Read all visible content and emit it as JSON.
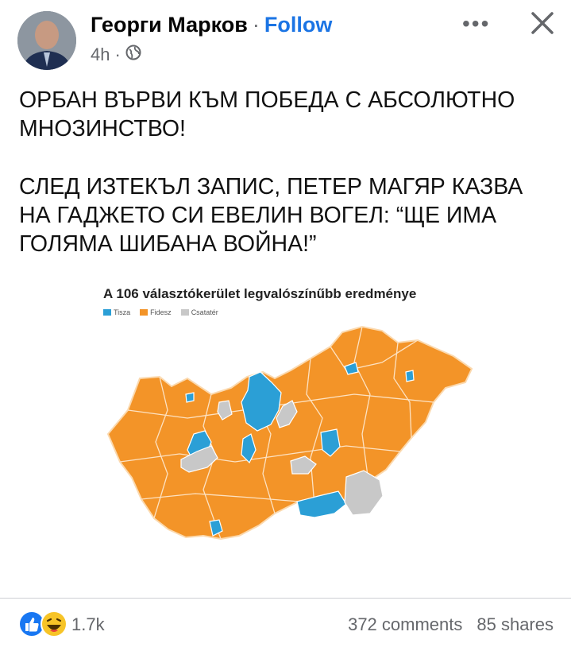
{
  "post": {
    "author": "Георги Марков",
    "separator": "·",
    "follow_label": "Follow",
    "time": "4h",
    "meta_separator": "·",
    "text_line1": "ОРБАН ВЪРВИ КЪМ ПОБЕДА С АБСОЛЮТНО МНОЗИНСТВО!",
    "text_line2": "СЛЕД ИЗТЕКЪЛ ЗАПИС, ПЕТЕР МАГЯР КАЗВА НА ГАДЖЕТО СИ ЕВЕЛИН ВОГЕЛ: “ЩЕ ИМА ГОЛЯМА ШИБАНА ВОЙНА!”"
  },
  "image": {
    "title": "A 106 választókerület legvalószínűbb eredménye",
    "legend": [
      {
        "label": "Tisza",
        "color": "#2b9fd6"
      },
      {
        "label": "Fidesz",
        "color": "#f39428"
      },
      {
        "label": "Csatatér",
        "color": "#c8c8c8"
      }
    ]
  },
  "footer": {
    "reaction_count": "1.7k",
    "comments": "372 comments",
    "shares": "85 shares"
  },
  "icons": {
    "globe": "globe-icon",
    "more": "more-options-icon",
    "close": "close-icon",
    "like": "like-reaction-icon",
    "haha": "haha-reaction-icon"
  }
}
